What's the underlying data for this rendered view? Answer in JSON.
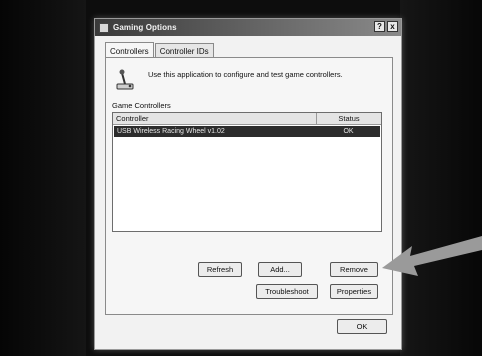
{
  "window": {
    "title": "Gaming Options",
    "help_glyph": "?",
    "close_glyph": "x"
  },
  "tabs": [
    {
      "label": "Controllers",
      "active": true
    },
    {
      "label": "Controller IDs",
      "active": false
    }
  ],
  "intro_text": "Use this application to configure and test game controllers.",
  "group_label": "Game Controllers",
  "list": {
    "columns": [
      "Controller",
      "Status"
    ],
    "rows": [
      {
        "controller": "USB Wireless Racing Wheel v1.02",
        "status": "OK",
        "selected": true
      }
    ]
  },
  "buttons": {
    "refresh": "Refresh",
    "add": "Add...",
    "remove": "Remove",
    "troubleshoot": "Troubleshoot",
    "properties": "Properties",
    "ok": "OK"
  },
  "colors": {
    "dialog_background": "#f2f2f2",
    "selected_row": "#2c2c2c",
    "arrow": "#9a9a9a"
  }
}
